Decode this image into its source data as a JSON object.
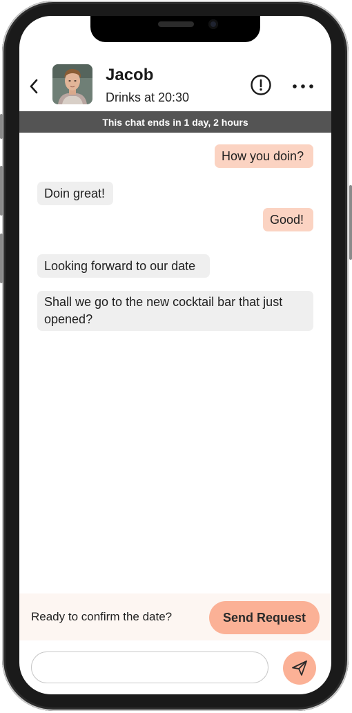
{
  "header": {
    "name": "Jacob",
    "subtitle": "Drinks at 20:30",
    "back_icon": "chevron-left-icon",
    "report_icon": "alert-circle-icon",
    "more_icon": "ellipsis-icon"
  },
  "banner": {
    "text": "This chat ends in 1 day, 2 hours"
  },
  "messages": [
    {
      "direction": "outgoing",
      "text": "How you doin?"
    },
    {
      "direction": "incoming",
      "text": "Doin great!"
    },
    {
      "direction": "outgoing",
      "text": "Good!"
    },
    {
      "direction": "incoming",
      "text": "Looking forward to our date"
    },
    {
      "direction": "incoming",
      "text": "Shall we go to the new cocktail bar that just opened?"
    }
  ],
  "confirm": {
    "prompt": "Ready to confirm the date?",
    "button_label": "Send Request"
  },
  "composer": {
    "value": "",
    "placeholder": "",
    "send_icon": "paper-plane-icon"
  },
  "colors": {
    "accent": "#fbb196",
    "outgoing_bubble": "#fbd3c2",
    "incoming_bubble": "#efefef",
    "banner": "#545454"
  }
}
